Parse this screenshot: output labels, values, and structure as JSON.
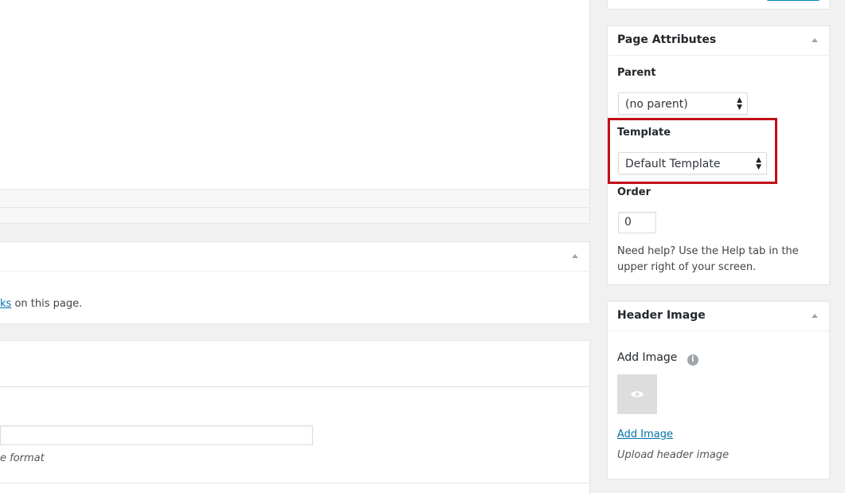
{
  "main": {
    "link_fragment": "ks",
    "link_suffix": " on this page.",
    "hint_text": "e format"
  },
  "page_attributes": {
    "title": "Page Attributes",
    "parent_label": "Parent",
    "parent_value": "(no parent)",
    "template_label": "Template",
    "template_value": "Default Template",
    "order_label": "Order",
    "order_value": "0",
    "help_text": "Need help? Use the Help tab in the upper right of your screen."
  },
  "header_image": {
    "title": "Header Image",
    "add_image_heading": "Add Image",
    "add_image_link": "Add Image",
    "upload_hint": "Upload header image"
  },
  "icons": {
    "toggle": "triangle-up-icon",
    "info": "info-icon",
    "preview": "eye-icon"
  },
  "colors": {
    "link": "#0073aa",
    "highlight": "#c0101a",
    "primary_button": "#0085ba"
  }
}
